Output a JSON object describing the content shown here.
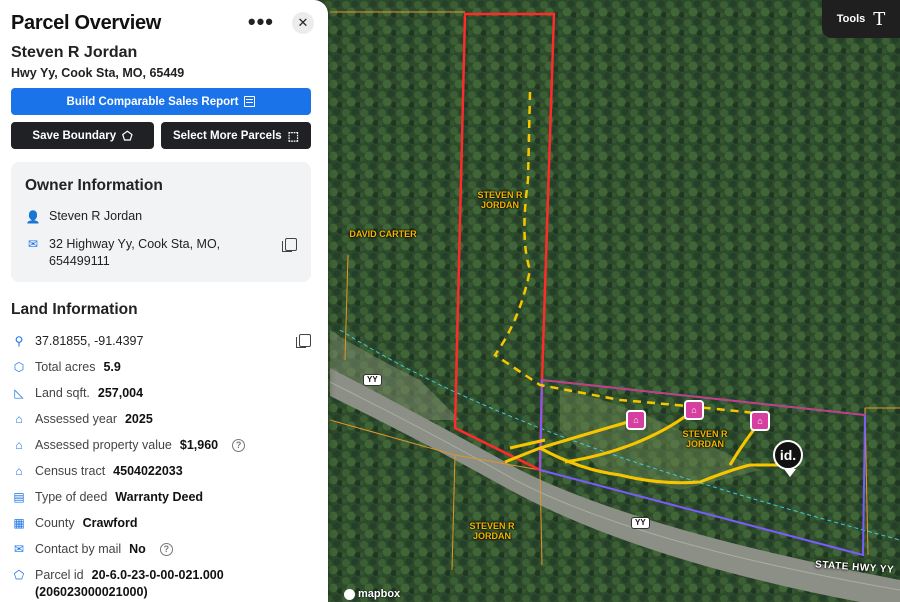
{
  "panel": {
    "title": "Parcel Overview",
    "owner_name": "Steven R Jordan",
    "owner_address": "Hwy Yy, Cook Sta, MO, 65449",
    "build_report_label": "Build Comparable Sales Report",
    "save_boundary_label": "Save Boundary",
    "select_more_label": "Select More Parcels"
  },
  "owner_info": {
    "title": "Owner Information",
    "name": "Steven R Jordan",
    "address_line1": "32 Highway Yy, Cook Sta, MO,",
    "address_line2": "654499111"
  },
  "land_info": {
    "title": "Land Information",
    "coordinates": "37.81855, -91.4397",
    "total_acres_label": "Total acres",
    "total_acres": "5.9",
    "land_sqft_label": "Land sqft.",
    "land_sqft": "257,004",
    "assessed_year_label": "Assessed year",
    "assessed_year": "2025",
    "assessed_value_label": "Assessed property value",
    "assessed_value": "$1,960",
    "census_tract_label": "Census tract",
    "census_tract": "4504022033",
    "deed_type_label": "Type of deed",
    "deed_type": "Warranty Deed",
    "county_label": "County",
    "county": "Crawford",
    "contact_mail_label": "Contact by mail",
    "contact_mail": "No",
    "parcel_id_label": "Parcel id",
    "parcel_id": "20-6.0-23-0-00-021.000",
    "parcel_id_alt": "(206023000021000)"
  },
  "map": {
    "tools_label": "Tools",
    "labels": {
      "steven_top": "STEVEN R JORDAN",
      "david": "DAVID CARTER",
      "steven_mid": "STEVEN R JORDAN",
      "steven_bottom": "STEVEN R JORDAN"
    },
    "road_sign_1": "YY",
    "road_sign_2": "YY",
    "road_name": "STATE HWY YY",
    "pin_label": "id.",
    "attribution": "mapbox"
  }
}
